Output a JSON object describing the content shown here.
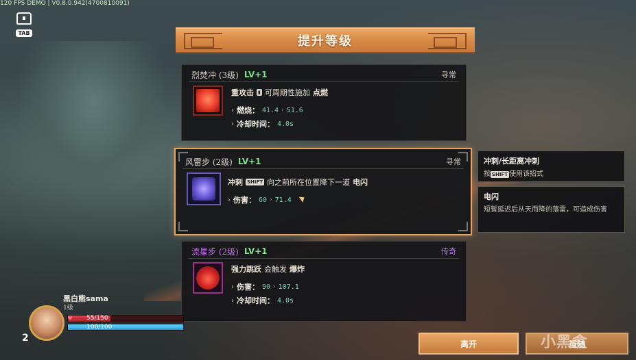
{
  "hud": {
    "fps_text": "120 FPS DEMO | V0.8.0.942(4700810091)",
    "tab_key": "TAB"
  },
  "title": "提升等级",
  "cards": [
    {
      "name": "烈焚冲 (3级)",
      "lv": "LV+1",
      "rarity": "寻常",
      "desc_pre": "重攻击",
      "desc_post": "可周期性施加",
      "desc_bold": "点燃",
      "stats": [
        {
          "label": "燃烧：",
          "old": "41.4",
          "new": "51.6"
        },
        {
          "label": "冷却时间：",
          "value": "4.0s"
        }
      ]
    },
    {
      "name": "风雷步 (2级)",
      "lv": "LV+1",
      "rarity": "寻常",
      "desc_pre": "冲刺",
      "key": "SHIFT",
      "desc_post": "向之前所在位置降下一道",
      "desc_bold": "电闪",
      "stats": [
        {
          "label": "伤害：",
          "old": "60",
          "new": "71.4"
        }
      ]
    },
    {
      "name": "流星步 (2级)",
      "lv": "LV+1",
      "rarity": "传奇",
      "desc_pre": "强力跳跃",
      "desc_post": "会触发",
      "desc_bold": "爆炸",
      "stats": [
        {
          "label": "伤害：",
          "old": "90",
          "new": "107.1"
        },
        {
          "label": "冷却时间：",
          "value": "4.0s"
        }
      ]
    }
  ],
  "tooltips": [
    {
      "title": "冲刺/长距离冲刺",
      "body_pre": "按",
      "key": "SHIFT",
      "body_post": "使用该招式"
    },
    {
      "title": "电闪",
      "body": "短暂延迟后从天而降的落雷，可造成伤害"
    }
  ],
  "player": {
    "name": "黑白熊sama",
    "level_label": "1级",
    "level_num": "2",
    "hp": "55/150",
    "hp_fraction": 0.367,
    "mp": "100/100",
    "mp_fraction": 1.0
  },
  "buttons": {
    "leave": "离开",
    "reroll": "重随"
  },
  "watermark": "小黑盒",
  "colors": {
    "accent_orange": "#e4a55e",
    "lv_green": "#7fe08a",
    "legend_purple": "#c476e8",
    "stat_value": "#7fd8b8"
  }
}
